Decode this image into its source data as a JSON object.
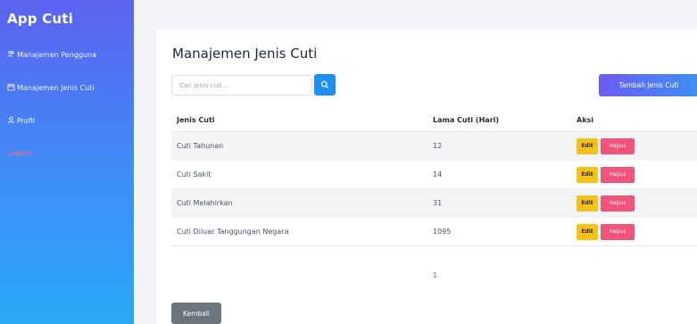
{
  "sidebar": {
    "app_title": "App Cuti",
    "items": [
      {
        "icon": "users-icon",
        "label": "Manajemen Pengguna"
      },
      {
        "icon": "calendar-icon",
        "label": "Manajemen Jenis Cuti"
      },
      {
        "icon": "profile-icon",
        "label": "Profil"
      }
    ],
    "logout_label": "Logout"
  },
  "main": {
    "title": "Manajemen Jenis Cuti",
    "search": {
      "placeholder": "Cari jenis cuti...",
      "value": ""
    },
    "add_button": "Tambah Jenis Cuti",
    "table": {
      "headers": [
        "Jenis Cuti",
        "Lama Cuti (Hari)",
        "Aksi"
      ],
      "rows": [
        {
          "jenis": "Cuti Tahunan",
          "lama": "12"
        },
        {
          "jenis": "Cuti Sakit",
          "lama": "14"
        },
        {
          "jenis": "Cuti Melahirkan",
          "lama": "31"
        },
        {
          "jenis": "Cuti Diluar Tanggungan Negara",
          "lama": "1095"
        }
      ],
      "edit_label": "Edit",
      "delete_label": "Hapus"
    },
    "pagination": "1",
    "back_button": "Kembali"
  },
  "colors": {
    "sidebar_top": "#5b63f0",
    "sidebar_bottom": "#27a9f5",
    "search_button": "#1d8ff2",
    "edit": "#f5c21b",
    "delete": "#f2537a",
    "back": "#6c757d",
    "logout": "#ff6b7a"
  }
}
